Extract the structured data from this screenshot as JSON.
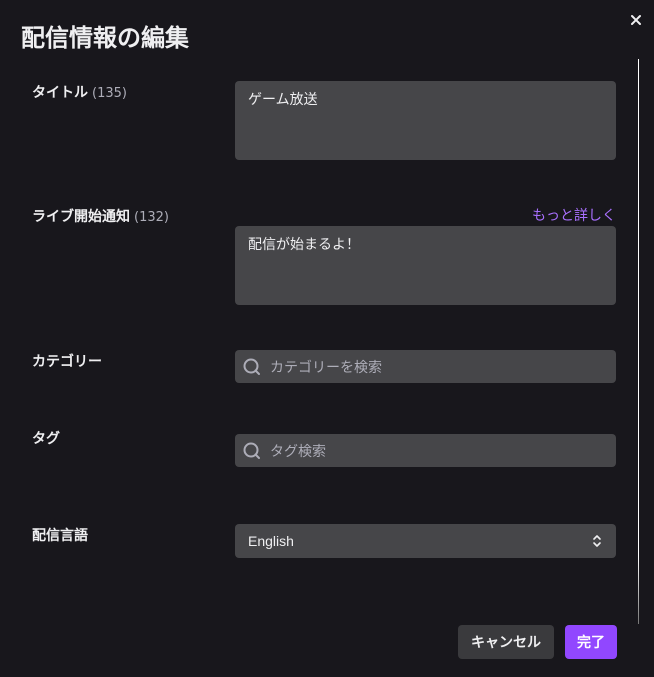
{
  "dialog": {
    "title": "配信情報の編集",
    "close_icon": "close-icon"
  },
  "fields": {
    "title": {
      "label": "タイトル",
      "count": "(135)",
      "value": "ゲーム放送"
    },
    "notification": {
      "label": "ライブ開始通知",
      "count": "(132)",
      "more_link": "もっと詳しく",
      "value": "配信が始まるよ！"
    },
    "category": {
      "label": "カテゴリー",
      "placeholder": "カテゴリーを検索",
      "icon": "search-icon"
    },
    "tags": {
      "label": "タグ",
      "placeholder": "タグ検索",
      "icon": "search-icon"
    },
    "language": {
      "label": "配信言語",
      "selected": "English",
      "icon": "updown-chevron-icon"
    }
  },
  "footer": {
    "cancel_label": "キャンセル",
    "done_label": "完了"
  },
  "colors": {
    "background": "#18171c",
    "input": "#464649",
    "accent": "#9147ff",
    "link": "#a970ff"
  }
}
